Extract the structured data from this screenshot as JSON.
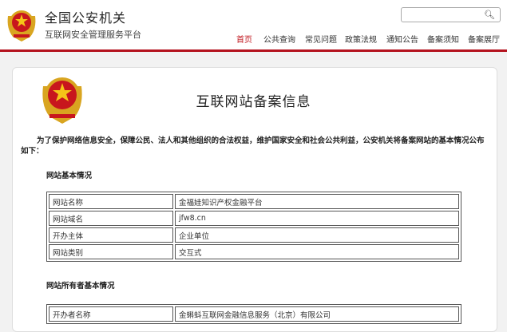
{
  "header": {
    "title": "全国公安机关",
    "subtitle": "互联网安全管理服务平台",
    "search": {
      "placeholder": "",
      "icon": "search-icon"
    },
    "nav": [
      {
        "label": "首页",
        "active": true
      },
      {
        "label": "公共查询",
        "active": false
      },
      {
        "label": "常见问题",
        "active": false
      },
      {
        "label": "政策法规",
        "active": false
      },
      {
        "label": "通知公告",
        "active": false
      },
      {
        "label": "备案须知",
        "active": false
      },
      {
        "label": "备案展厅",
        "active": false
      }
    ],
    "accent_color": "#b4121e"
  },
  "main": {
    "title": "互联网站备案信息",
    "intro_line1": "为了保护网络信息安全，保障公民、法人和其他组织的合法权益，维护国家安全和社会公共利益，公安机关将备案网站的基本情况公布",
    "intro_line2": "如下：",
    "website_section": {
      "title": "网站基本情况",
      "rows": [
        {
          "label": "网站名称",
          "value": "金福娃知识产权金融平台"
        },
        {
          "label": "网站域名",
          "value": "jfw8.cn"
        },
        {
          "label": "开办主体",
          "value": "企业单位"
        },
        {
          "label": "网站类别",
          "value": "交互式"
        }
      ]
    },
    "owner_section": {
      "title": "网站所有者基本情况",
      "rows": [
        {
          "label": "开办者名称",
          "value": "金蝌蚪互联网金融信息服务（北京）有限公司"
        }
      ]
    }
  }
}
